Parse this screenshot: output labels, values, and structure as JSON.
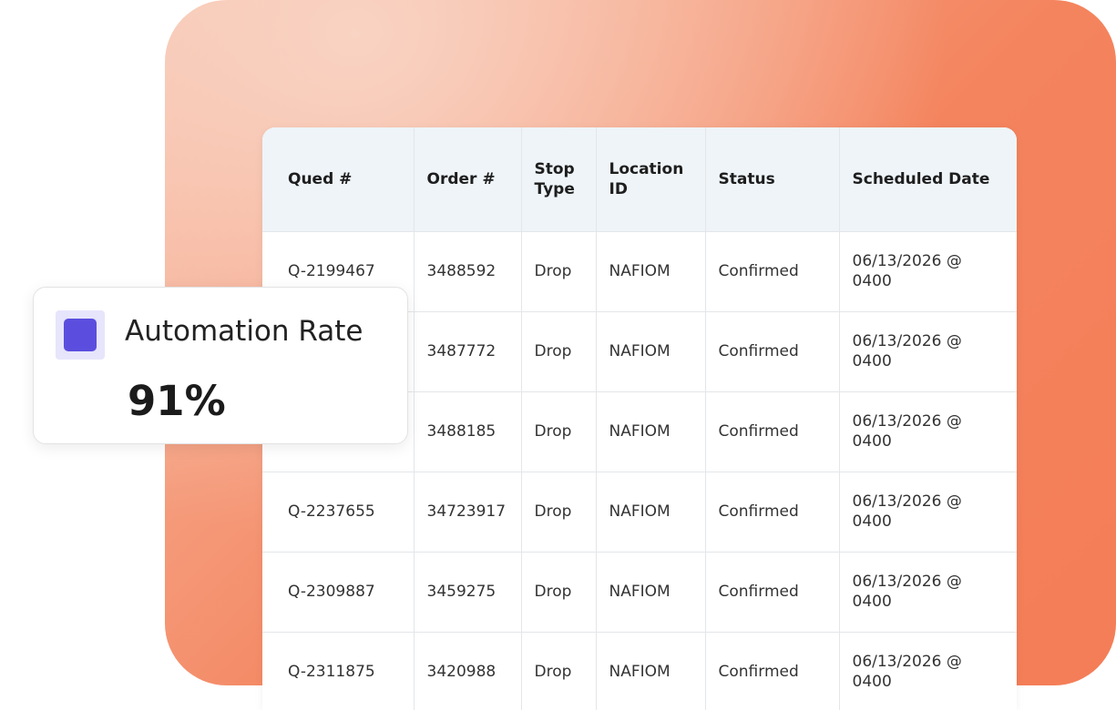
{
  "table": {
    "headers": [
      "Qued #",
      "Order #",
      "Stop Type",
      "Location ID",
      "Status",
      "Scheduled Date"
    ],
    "rows": [
      [
        "Q-2199467",
        "3488592",
        "Drop",
        "NAFIOM",
        "Confirmed",
        "06/13/2026 @ 0400"
      ],
      [
        "",
        "3487772",
        "Drop",
        "NAFIOM",
        "Confirmed",
        "06/13/2026 @ 0400"
      ],
      [
        "",
        "3488185",
        "Drop",
        "NAFIOM",
        "Confirmed",
        "06/13/2026 @ 0400"
      ],
      [
        "Q-2237655",
        "34723917",
        "Drop",
        "NAFIOM",
        "Confirmed",
        "06/13/2026 @ 0400"
      ],
      [
        "Q-2309887",
        "3459275",
        "Drop",
        "NAFIOM",
        "Confirmed",
        "06/13/2026 @ 0400"
      ],
      [
        "Q-2311875",
        "3420988",
        "Drop",
        "NAFIOM",
        "Confirmed",
        "06/13/2026 @ 0400"
      ]
    ]
  },
  "metric": {
    "label": "Automation Rate",
    "value": "91%",
    "icon": "square-icon",
    "icon_color": "#5b4ede"
  },
  "colors": {
    "background_accent": "#f4845e",
    "header_bg": "#eef4f8"
  }
}
